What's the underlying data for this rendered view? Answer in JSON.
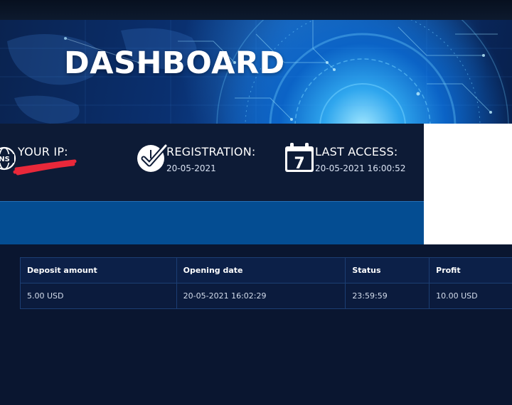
{
  "hero": {
    "title": "DASHBOARD"
  },
  "info": {
    "ip": {
      "icon": "globe-www-icon",
      "label": "YOUR IP:",
      "value": ""
    },
    "registration": {
      "icon": "check-clock-icon",
      "label": "REGISTRATION:",
      "value": "20-05-2021"
    },
    "last_access": {
      "icon": "calendar-icon",
      "label": "LAST ACCESS:",
      "value": "20-05-2021 16:00:52",
      "calendar_day": "7"
    }
  },
  "table": {
    "headers": [
      "Deposit amount",
      "Opening date",
      "Status",
      "Profit"
    ],
    "rows": [
      [
        "5.00 USD",
        "20-05-2021 16:02:29",
        "23:59:59",
        "10.00 USD"
      ]
    ]
  },
  "colors": {
    "background": "#0a1630",
    "info_panel": "#0d1b36",
    "blue_band": "#044d92",
    "redaction": "#e8283a"
  }
}
